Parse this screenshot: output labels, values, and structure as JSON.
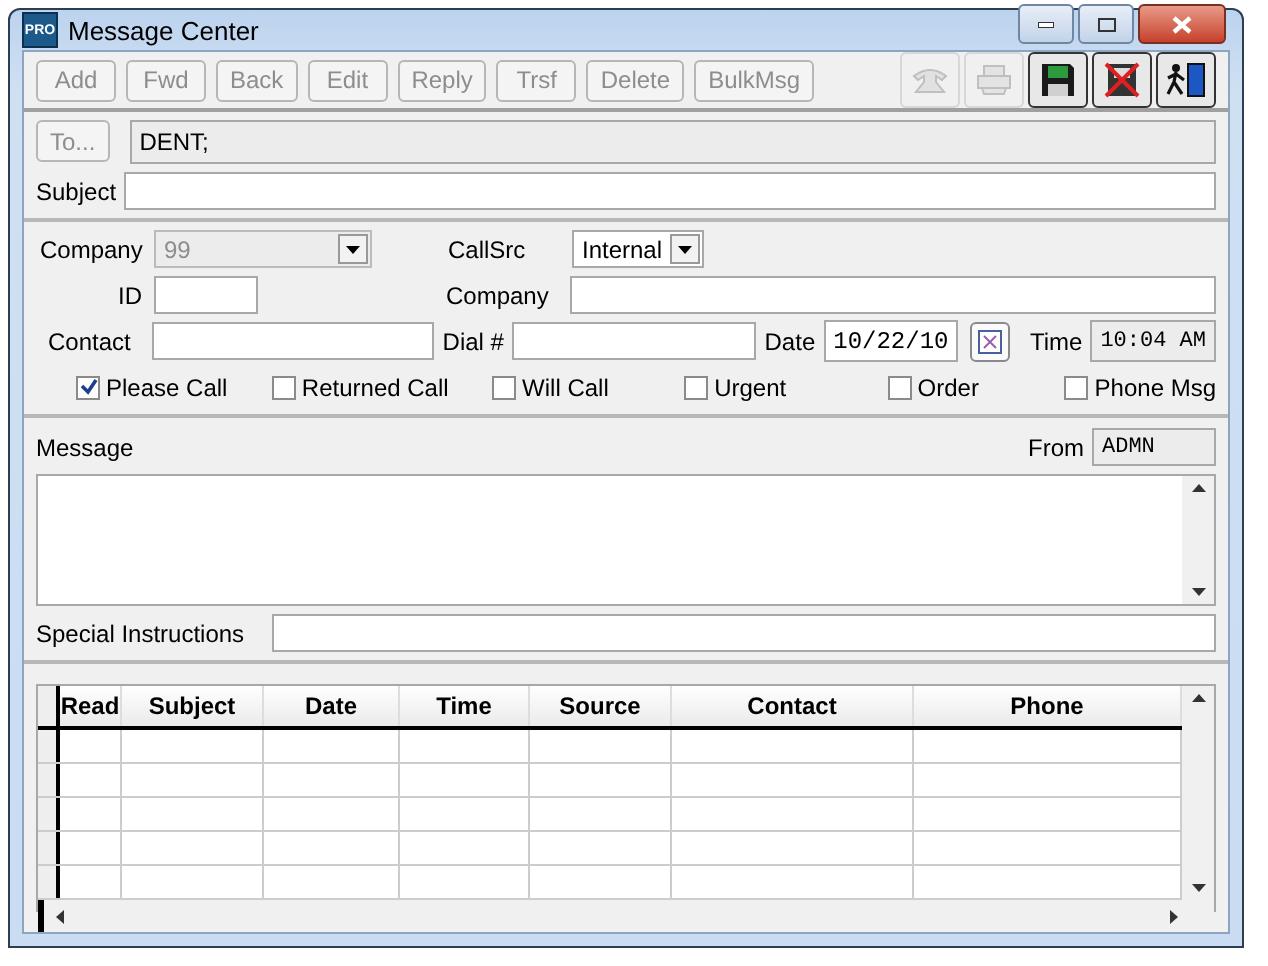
{
  "window": {
    "logo": "PRO",
    "title": "Message Center"
  },
  "toolbar": {
    "buttons": [
      {
        "label": "Add",
        "disabled": true
      },
      {
        "label": "Fwd",
        "disabled": true
      },
      {
        "label": "Back",
        "disabled": true
      },
      {
        "label": "Edit",
        "disabled": true
      },
      {
        "label": "Reply",
        "disabled": true
      },
      {
        "label": "Trsf",
        "disabled": true
      },
      {
        "label": "Delete",
        "disabled": true
      },
      {
        "label": "BulkMsg",
        "disabled": true
      }
    ],
    "icon_buttons": [
      {
        "kind": "phone",
        "disabled": true
      },
      {
        "kind": "printer",
        "disabled": true
      },
      {
        "kind": "save",
        "disabled": false
      },
      {
        "kind": "cancel",
        "disabled": false
      },
      {
        "kind": "exit",
        "disabled": false
      }
    ]
  },
  "to": {
    "button": "To...",
    "disabled": true,
    "value": "DENT;"
  },
  "subject": {
    "label": "Subject"
  },
  "company_select": {
    "label": "Company",
    "value": "99",
    "disabled": true
  },
  "callsrc": {
    "label": "CallSrc",
    "value": "Internal"
  },
  "id": {
    "label": "ID"
  },
  "company": {
    "label": "Company"
  },
  "contact": {
    "label": "Contact"
  },
  "dial": {
    "label": "Dial #"
  },
  "date": {
    "label": "Date",
    "value": "10/22/10"
  },
  "time": {
    "label": "Time",
    "value": "10:04 AM"
  },
  "checkboxes": [
    {
      "label": "Please Call",
      "checked": true
    },
    {
      "label": "Returned Call",
      "checked": false
    },
    {
      "label": "Will Call",
      "checked": false
    },
    {
      "label": "Urgent",
      "checked": false
    },
    {
      "label": "Order",
      "checked": false
    },
    {
      "label": "Phone Msg",
      "checked": false
    }
  ],
  "message": {
    "label": "Message"
  },
  "from": {
    "label": "From",
    "value": "ADMN"
  },
  "special_instructions": {
    "label": "Special Instructions"
  },
  "grid": {
    "columns": [
      "Read",
      "Subject",
      "Date",
      "Time",
      "Source",
      "Contact",
      "Phone"
    ]
  }
}
